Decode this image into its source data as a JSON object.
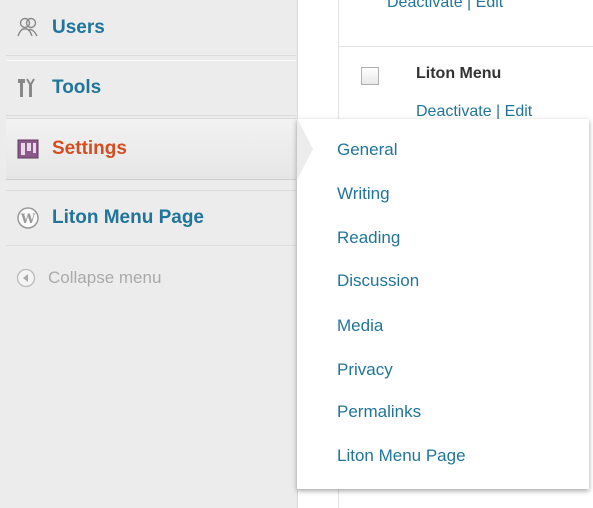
{
  "sidebar": {
    "items": [
      {
        "label": "Users",
        "icon": "users-icon"
      },
      {
        "label": "Tools",
        "icon": "tools-icon"
      },
      {
        "label": "Settings",
        "icon": "settings-icon",
        "current": true
      },
      {
        "label": "Liton Menu Page",
        "icon": "wordpress-icon"
      }
    ],
    "collapse_label": "Collapse menu"
  },
  "content": {
    "row1_actions": "Deactivate | Edit",
    "plugin_name": "Liton Menu",
    "row2_actions": "Deactivate | Edit"
  },
  "submenu": {
    "items": [
      "General",
      "Writing",
      "Reading",
      "Discussion",
      "Media",
      "Privacy",
      "Permalinks",
      "Liton Menu Page"
    ]
  },
  "colors": {
    "link": "#21759b",
    "current": "#d54e21",
    "sidebar_bg": "#ececec",
    "muted": "#aaaaaa"
  }
}
